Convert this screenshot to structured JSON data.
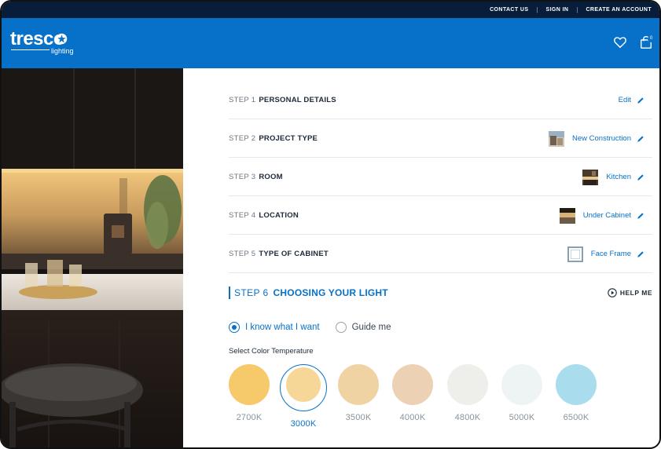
{
  "utility_nav": [
    "CONTACT US",
    "SIGN IN",
    "CREATE AN ACCOUNT"
  ],
  "logo": {
    "brand": "tresco",
    "sub": "lighting"
  },
  "header": {
    "heart_icon": "heart-icon",
    "bag_icon": "shopping-bag-icon",
    "bag_count": "0"
  },
  "steps": [
    {
      "num": "STEP 1",
      "title": "PERSONAL DETAILS",
      "value": "Edit",
      "thumb": "none"
    },
    {
      "num": "STEP 2",
      "title": "PROJECT TYPE",
      "value": "New Construction",
      "thumb": "construction-thumbnail"
    },
    {
      "num": "STEP 3",
      "title": "ROOM",
      "value": "Kitchen",
      "thumb": "kitchen-thumbnail"
    },
    {
      "num": "STEP 4",
      "title": "LOCATION",
      "value": "Under Cabinet",
      "thumb": "under-cabinet-thumbnail"
    },
    {
      "num": "STEP 5",
      "title": "TYPE OF CABINET",
      "value": "Face Frame",
      "thumb": "face-frame-icon"
    }
  ],
  "step6": {
    "num": "STEP 6",
    "title": "CHOOSING YOUR LIGHT",
    "help": "HELP ME"
  },
  "modes": [
    {
      "label": "I know what I want",
      "selected": true
    },
    {
      "label": "Guide me",
      "selected": false
    }
  ],
  "color_temp": {
    "label": "Select Color Temperature",
    "selected": "3000K",
    "options": [
      {
        "label": "2700K",
        "color": "#f6c96a"
      },
      {
        "label": "3000K",
        "color": "#f6d797"
      },
      {
        "label": "3500K",
        "color": "#efd3a2"
      },
      {
        "label": "4000K",
        "color": "#ecd1b5"
      },
      {
        "label": "4800K",
        "color": "#eeefea"
      },
      {
        "label": "5000K",
        "color": "#eef4f4"
      },
      {
        "label": "6500K",
        "color": "#a9dcec"
      }
    ]
  },
  "colors": {
    "brand_blue": "#0771c9",
    "topbar": "#071d3a"
  }
}
